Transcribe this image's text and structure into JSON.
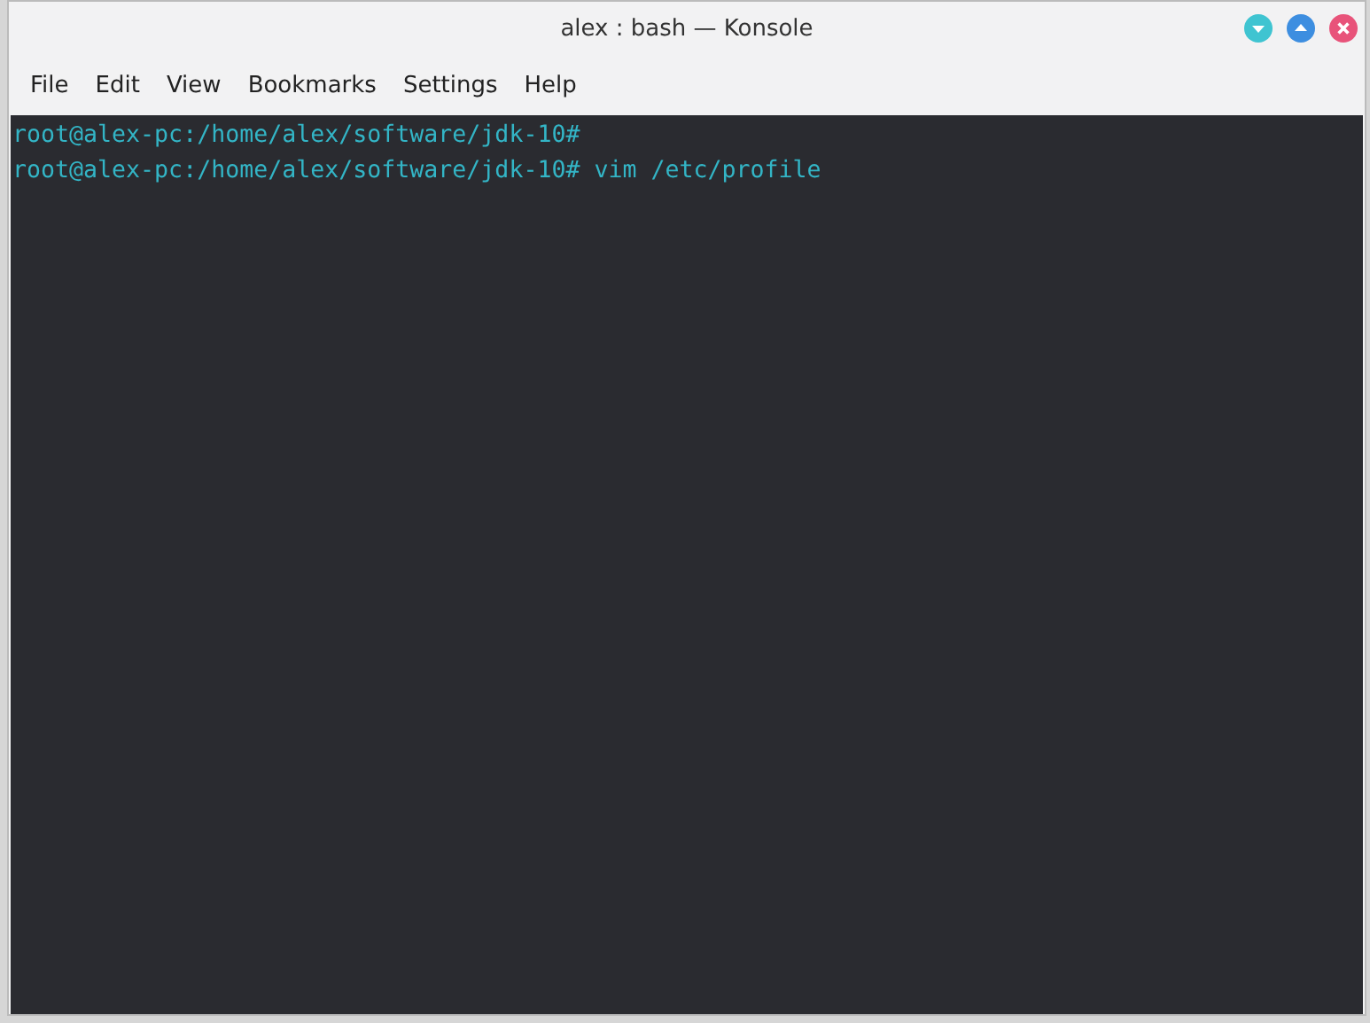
{
  "window": {
    "title": "alex : bash — Konsole"
  },
  "menu": [
    "File",
    "Edit",
    "View",
    "Bookmarks",
    "Settings",
    "Help"
  ],
  "terminal": {
    "lines": [
      {
        "prompt": "root@alex-pc:/home/alex/software/jdk-10#"
      },
      {
        "prompt": "root@alex-pc:/home/alex/software/jdk-10#",
        "command": "vim /etc/profile"
      }
    ]
  }
}
